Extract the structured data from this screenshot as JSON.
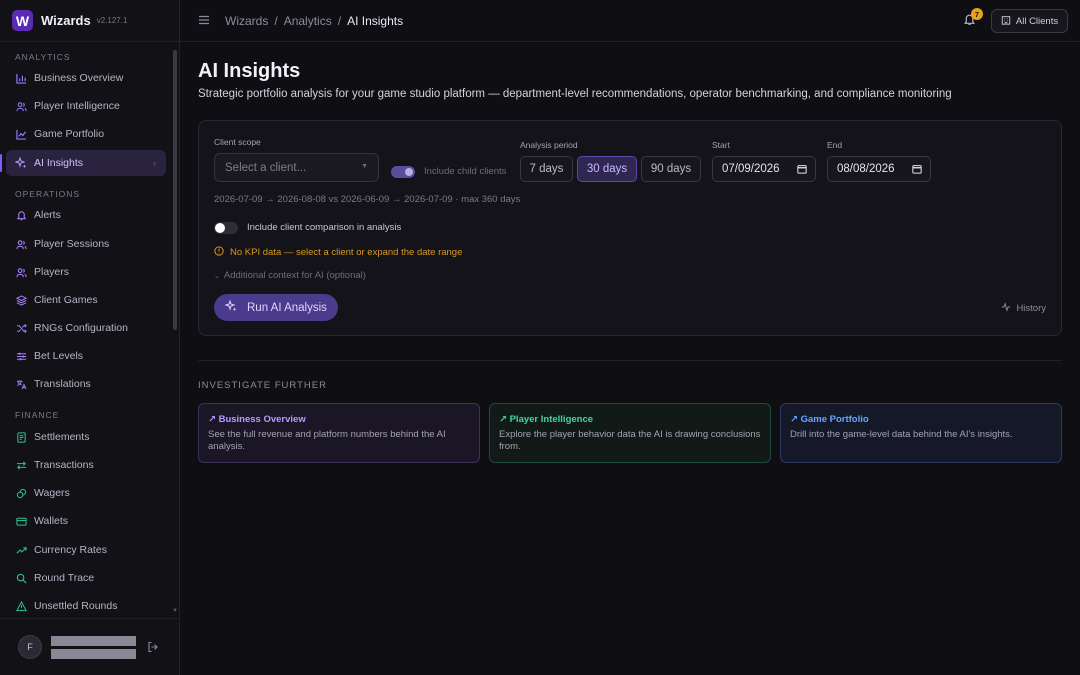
{
  "brand": {
    "name": "Wizards",
    "version": "v2.127.1",
    "logo_letter": "W"
  },
  "sidebar": {
    "sections": [
      {
        "title": "ANALYTICS",
        "items": [
          {
            "label": "Business Overview",
            "icon": "bar-chart-icon"
          },
          {
            "label": "Player Intelligence",
            "icon": "users-icon"
          },
          {
            "label": "Game Portfolio",
            "icon": "line-chart-icon"
          },
          {
            "label": "AI Insights",
            "icon": "sparkles-icon",
            "active": true
          }
        ]
      },
      {
        "title": "OPERATIONS",
        "items": [
          {
            "label": "Alerts",
            "icon": "bell-icon"
          },
          {
            "label": "Player Sessions",
            "icon": "users-icon"
          },
          {
            "label": "Players",
            "icon": "users-icon"
          },
          {
            "label": "Client Games",
            "icon": "layers-icon"
          },
          {
            "label": "RNGs Configuration",
            "icon": "shuffle-icon"
          },
          {
            "label": "Bet Levels",
            "icon": "sliders-icon"
          },
          {
            "label": "Translations",
            "icon": "languages-icon"
          }
        ]
      },
      {
        "title": "FINANCE",
        "items": [
          {
            "label": "Settlements",
            "icon": "receipt-icon"
          },
          {
            "label": "Transactions",
            "icon": "arrows-icon"
          },
          {
            "label": "Wagers",
            "icon": "coins-icon"
          },
          {
            "label": "Wallets",
            "icon": "wallet-icon"
          },
          {
            "label": "Currency Rates",
            "icon": "trending-up-icon"
          },
          {
            "label": "Round Trace",
            "icon": "search-icon"
          },
          {
            "label": "Unsettled Rounds",
            "icon": "alert-triangle-icon"
          }
        ]
      }
    ],
    "user": {
      "initial": "F"
    }
  },
  "topbar": {
    "breadcrumb": [
      "Wizards",
      "Analytics",
      "AI Insights"
    ],
    "separator": "/",
    "notification_count": "7",
    "clients_button": "All Clients"
  },
  "page": {
    "title": "AI Insights",
    "subtitle": "Strategic portfolio analysis for your game studio platform — department-level recommendations, operator benchmarking, and compliance monitoring"
  },
  "form": {
    "client_scope_label": "Client scope",
    "client_placeholder": "Select a client...",
    "include_child_label": "Include child clients",
    "include_child_on": true,
    "period_label": "Analysis period",
    "periods": [
      "7 days",
      "30 days",
      "90 days"
    ],
    "selected_period": "30 days",
    "start_label": "Start",
    "start_value": "07/09/2026",
    "end_label": "End",
    "end_value": "08/08/2026",
    "range_summary": "2026-07-09 → 2026-08-08 vs 2026-06-09 → 2026-07-09 · max 360 days",
    "comparison_label": "Include client comparison in analysis",
    "comparison_on": false,
    "warning": "No KPI data — select a client or expand the date range",
    "additional_context": "Additional context for AI (optional)",
    "run_button": "Run AI Analysis",
    "history_button": "History"
  },
  "investigate": {
    "title": "INVESTIGATE FURTHER",
    "cards": [
      {
        "title": "↗ Business Overview",
        "desc": "See the full revenue and platform numbers behind the AI analysis."
      },
      {
        "title": "↗ Player Intelligence",
        "desc": "Explore the player behavior data the AI is drawing conclusions from."
      },
      {
        "title": "↗ Game Portfolio",
        "desc": "Drill into the game-level data behind the AI's insights."
      }
    ]
  },
  "colors": {
    "accent": "#7c5cff",
    "warning": "#d99a1e",
    "analytics_icons": "#8a7dff",
    "operations_icons": "#a77bff",
    "finance_icons": "#2fc48d"
  }
}
